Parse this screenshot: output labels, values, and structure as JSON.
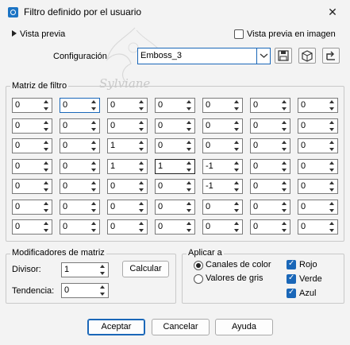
{
  "window": {
    "title": "Filtro definido por el usuario",
    "close_glyph": "✕"
  },
  "preview": {
    "toggle_label": "Vista previa",
    "checkbox_label": "Vista previa en imagen"
  },
  "watermark": {
    "text": "Sylviane"
  },
  "config": {
    "label": "Configuración",
    "value": "Emboss_3",
    "buttons": [
      "save-icon",
      "3d-cube-icon",
      "reset-icon"
    ]
  },
  "matrix": {
    "label": "Matriz de filtro",
    "rows": [
      [
        "0",
        "0",
        "0",
        "0",
        "0",
        "0",
        "0"
      ],
      [
        "0",
        "0",
        "0",
        "0",
        "0",
        "0",
        "0"
      ],
      [
        "0",
        "0",
        "1",
        "0",
        "0",
        "0",
        "0"
      ],
      [
        "0",
        "0",
        "1",
        "1",
        "-1",
        "0",
        "0"
      ],
      [
        "0",
        "0",
        "0",
        "0",
        "-1",
        "0",
        "0"
      ],
      [
        "0",
        "0",
        "0",
        "0",
        "0",
        "0",
        "0"
      ],
      [
        "0",
        "0",
        "0",
        "0",
        "0",
        "0",
        "0"
      ]
    ]
  },
  "modifiers": {
    "label": "Modificadores de matriz",
    "divisor_label": "Divisor:",
    "divisor_value": "1",
    "bias_label": "Tendencia:",
    "bias_value": "0",
    "calc_button": "Calcular"
  },
  "apply": {
    "label": "Aplicar a",
    "radio_color": "Canales de color",
    "radio_gray": "Valores de gris",
    "red": "Rojo",
    "green": "Verde",
    "blue": "Azul"
  },
  "footer": {
    "ok": "Aceptar",
    "cancel": "Cancelar",
    "help": "Ayuda"
  },
  "colors": {
    "accent": "#1a67b8",
    "background": "#f3f3f3"
  }
}
